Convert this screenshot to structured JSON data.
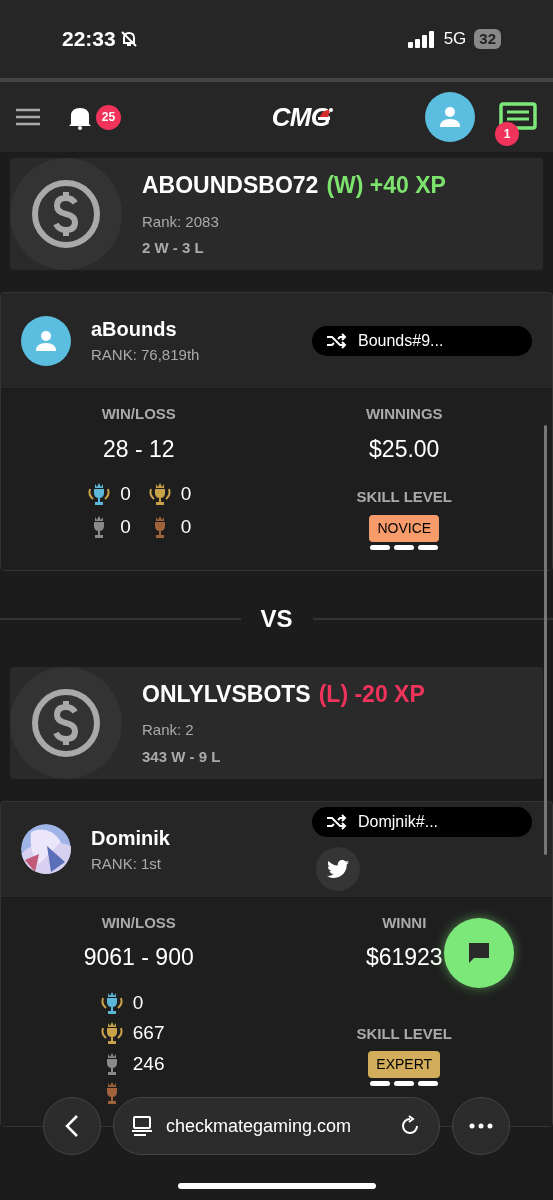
{
  "status": {
    "time": "22:33",
    "network": "5G",
    "battery": "32"
  },
  "header": {
    "notifications": "25",
    "logo": "CMG",
    "messages": "1"
  },
  "players": [
    {
      "summary": {
        "name": "ABOUNDSBO72",
        "kind": "win",
        "result": "(W) +40 XP",
        "rank": "Rank: 2083",
        "record": "2 W - 3 L"
      },
      "profile": {
        "name": "aBounds",
        "avatar": {
          "kind": "default"
        },
        "rank": "RANK: 76,819th",
        "tag": "Bounds#9...",
        "win_loss_label": "WIN/LOSS",
        "win_loss": "28 - 12",
        "winnings_label": "WINNINGS",
        "winnings": "$25.00",
        "trophy_panel": {
          "kind": "grid",
          "items": [
            {
              "kind": "champion",
              "count": "0"
            },
            {
              "kind": "gold",
              "count": "0"
            },
            {
              "kind": "silver",
              "count": "0"
            },
            {
              "kind": "bronze",
              "count": "0"
            }
          ]
        },
        "skill_label": "SKILL LEVEL",
        "skill": {
          "text": "NOVICE",
          "kind": "novice"
        }
      }
    },
    {
      "summary": {
        "name": "ONLYLVSBOTS",
        "kind": "loss",
        "result": "(L) -20 XP",
        "rank": "Rank: 2",
        "record": "343 W - 9 L"
      },
      "profile": {
        "name": "Dominik",
        "rank": "RANK: 1st",
        "tag": "Domjnik#...",
        "social": [
          {
            "kind": "twitter"
          }
        ],
        "win_loss_label": "WIN/LOSS",
        "win_loss": "9061 - 900",
        "winnings_label": "WINNI",
        "winnings": "$61923",
        "trophy_panel": {
          "kind": "list",
          "items": [
            {
              "kind": "champion",
              "count": "0"
            },
            {
              "kind": "gold",
              "count": "667"
            },
            {
              "kind": "silver",
              "count": "246"
            },
            {
              "kind": "bronze"
            }
          ]
        },
        "skill_label": "SKILL LEVEL",
        "skill": {
          "text": "EXPERT",
          "kind": "expert"
        }
      }
    }
  ],
  "vs": "VS",
  "browser": {
    "url": "checkmategaming.com"
  }
}
